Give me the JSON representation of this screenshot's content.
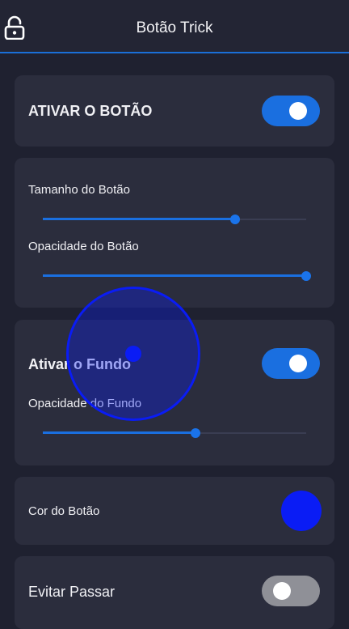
{
  "header": {
    "title": "Botão Trick",
    "lock_icon": "unlock-icon"
  },
  "enable_card": {
    "label": "ATIVAR O BOTÃO",
    "toggle_on": true
  },
  "size_card": {
    "size_label": "Tamanho do Botão",
    "size_value": 0.73,
    "opacity_label": "Opacidade do Botão",
    "opacity_value": 1.0
  },
  "background_card": {
    "label": "Ativar o Fundo",
    "toggle_on": true,
    "opacity_label": "Opacidade do Fundo",
    "opacity_value": 0.58
  },
  "color_card": {
    "label": "Cor do Botão",
    "color": "#0a1cf5"
  },
  "avoid_card": {
    "label": "Evitar Passar",
    "toggle_on": false
  },
  "colors": {
    "accent": "#1a6fe0",
    "background": "#1f2130",
    "card": "#2b2d3d"
  }
}
